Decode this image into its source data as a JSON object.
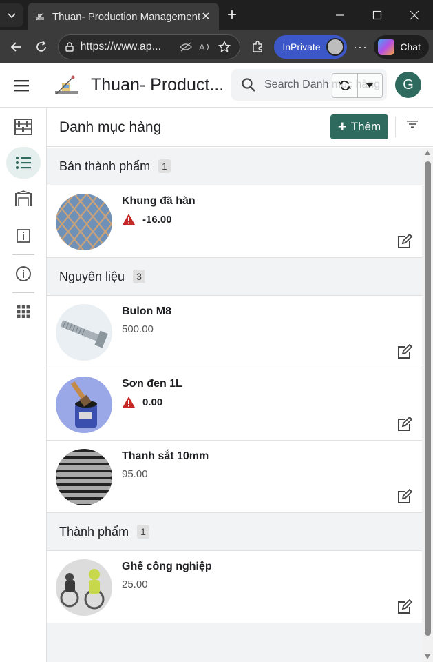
{
  "browser": {
    "tab_title": "Thuan- Production Management",
    "url": "https://www.ap...",
    "inprivate_label": "InPrivate",
    "chat_label": "Chat"
  },
  "app": {
    "title": "Thuan- Product...",
    "search_placeholder": "Search Danh mục hàng",
    "avatar_initial": "G"
  },
  "page": {
    "title": "Danh mục hàng",
    "add_label": "Thêm"
  },
  "groups": [
    {
      "name": "Bán thành phẩm",
      "count": "1",
      "items": [
        {
          "name": "Khung đã hàn",
          "qty": "-16.00",
          "warning": true
        }
      ]
    },
    {
      "name": "Nguyên liệu",
      "count": "3",
      "items": [
        {
          "name": "Bulon M8",
          "qty": "500.00",
          "warning": false
        },
        {
          "name": "Sơn đen 1L",
          "qty": "0.00",
          "warning": true
        },
        {
          "name": "Thanh sắt 10mm",
          "qty": "95.00",
          "warning": false
        }
      ]
    },
    {
      "name": "Thành phẩm",
      "count": "1",
      "items": [
        {
          "name": "Ghế công nghiệp",
          "qty": "25.00",
          "warning": false
        }
      ]
    }
  ],
  "colors": {
    "primary": "#2e6b5e",
    "warning": "#c62828"
  }
}
